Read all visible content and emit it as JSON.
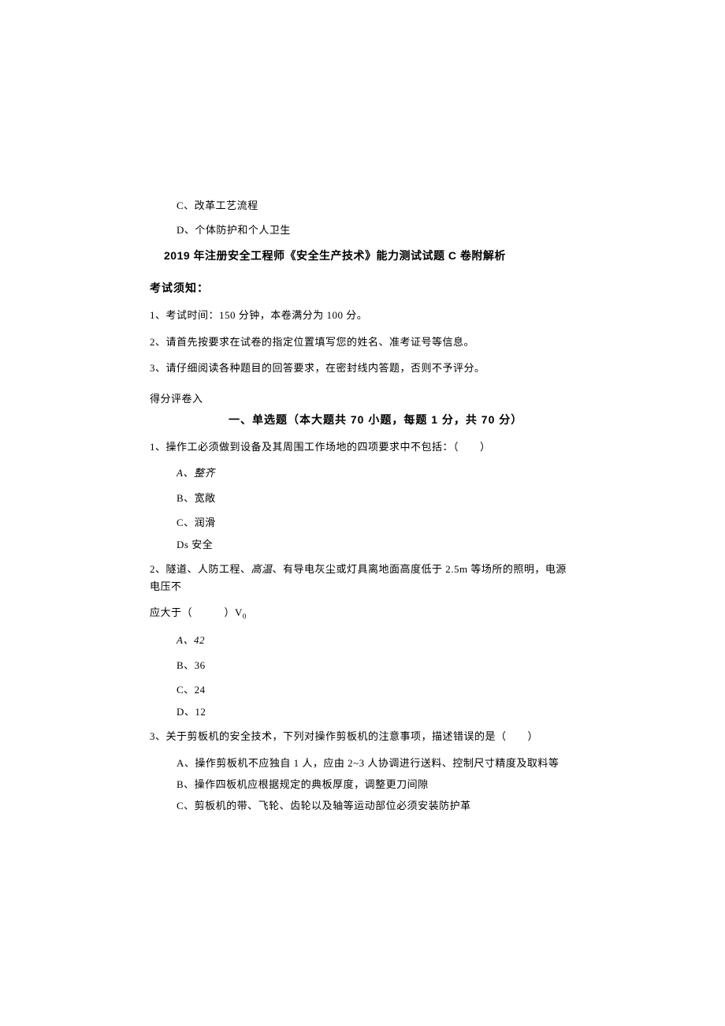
{
  "prelude": {
    "optC": "C、改革工艺流程",
    "optD": "D、个体防护和个人卫生"
  },
  "title": "2019 年注册安全工程师《安全生产技术》能力测试试题 C 卷附解析",
  "notice_header": "考试须知：",
  "instructions": [
    "1、考试时间：150 分钟，本卷满分为 100 分。",
    "2、请首先按要求在试卷的指定位置填写您的姓名、准考证号等信息。",
    "3、请仔细阅读各种题目的回答要求，在密封线内答题，否则不予评分。"
  ],
  "score_line": "得分评卷入",
  "part1_title": "一、单选题（本大题共 70 小题，每题 1 分，共 70 分）",
  "q1": {
    "stem": "1、操作工必须做到设备及其周围工作场地的四项要求中不包括：（　　）",
    "a": "A、整齐",
    "b": "B、宽敞",
    "c": "C、润滑",
    "d": "Ds 安全"
  },
  "q2": {
    "stem_part1": "2、隧道、人防工程、",
    "stem_italic": "高温",
    "stem_part2": "、有导电灰尘或灯具离地面高度低于 2.5m 等场所的照明，电源电压不",
    "stem_line2_a": "应大于（　　　）V",
    "stem_line2_sub": "0",
    "a": "A、42",
    "b": "B、36",
    "c": "C、24",
    "d": "D、12"
  },
  "q3": {
    "stem": "3、关于剪板机的安全技术，下列对操作剪板机的注意事项，描述错误的是（　　）",
    "a": "A、操作剪板机不应独自 1 人，应由 2~3 人协调进行送料、控制尺寸精度及取料等",
    "b": "B、操作四板机应根据规定的典板厚度，调整更刀间隙",
    "c": "C、剪板机的带、飞轮、齿轮以及轴等运动部位必须安装防护革"
  }
}
